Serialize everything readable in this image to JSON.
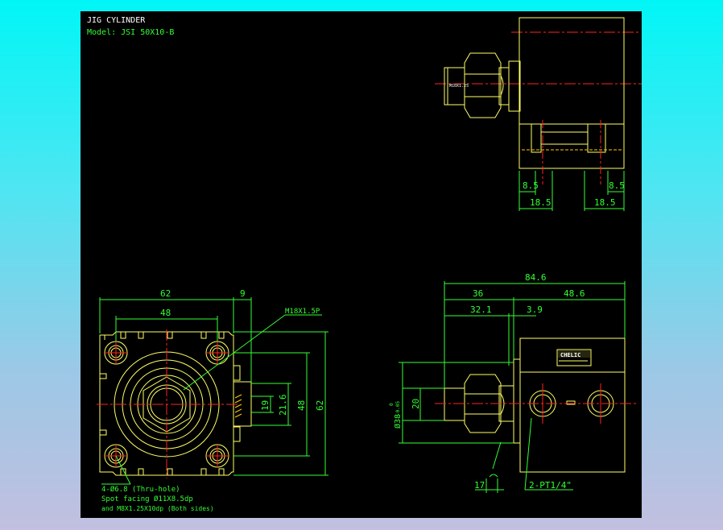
{
  "title": {
    "name": "JIG CYLINDER",
    "model": "Model: JSI 50X10-B"
  },
  "top_view": {
    "dims": {
      "left_small": "8.5",
      "left_big": "18.5",
      "right_small": "8.5",
      "right_big": "18.5"
    },
    "rod_label": "M10X1.25"
  },
  "front_view": {
    "dims": {
      "width": "62",
      "width_side": "9",
      "hole_pitch": "48",
      "h19": "19",
      "h21_6": "21.6",
      "h48": "48",
      "h62": "62"
    },
    "thread_callout": "M18X1.5P",
    "notes": [
      "4-Ø6.8   (Thru-hole)",
      "Spot facing  Ø11X8.5dp",
      "and M8X1.25X10dp (Both sides)"
    ]
  },
  "side_view": {
    "dims": {
      "total": "84.6",
      "left": "36",
      "right": "48.6",
      "d32_1": "32.1",
      "d3_9": "3.9",
      "d20": "20",
      "dia38": "Ø38",
      "tol_upper": "0",
      "tol_lower": "-0.05",
      "d17": "17"
    },
    "port_callout": "2-PT1/4\"",
    "brand": "CHELIC"
  },
  "colors": {
    "outline": "#ffff66",
    "dimension": "#33ff33",
    "center": "#ff2222",
    "text": "#ffffff",
    "hidden": "#ffcc00"
  }
}
